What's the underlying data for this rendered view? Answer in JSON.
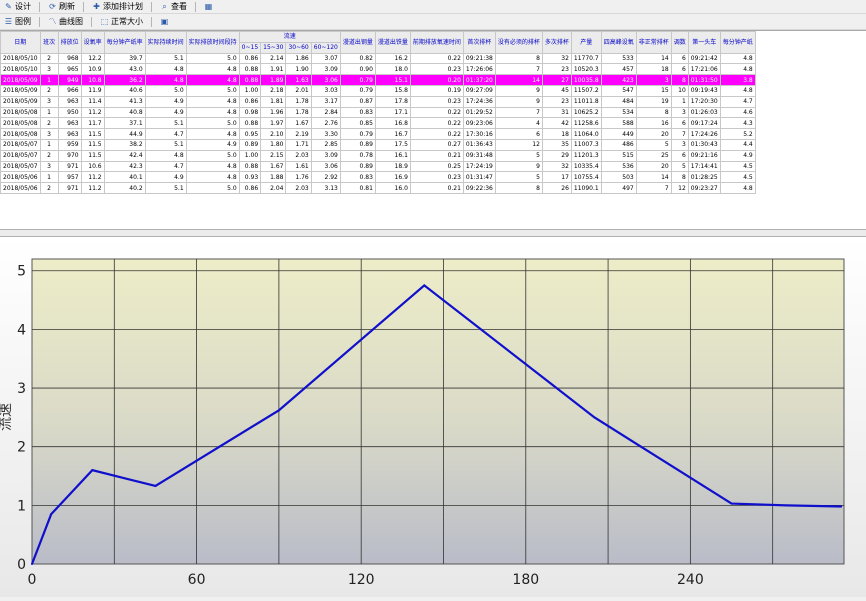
{
  "toolbar1": [
    {
      "icon": "design-icon",
      "label": "设计"
    },
    {
      "icon": "refresh-icon",
      "label": "刷新"
    },
    {
      "icon": "add-plan-icon",
      "label": "添加排计划"
    },
    {
      "icon": "view-icon",
      "label": "查看"
    },
    {
      "icon": "export-icon",
      "label": ""
    }
  ],
  "toolbar2": [
    {
      "icon": "legend-icon",
      "label": "图例"
    },
    {
      "icon": "curve-icon",
      "label": "曲线图"
    },
    {
      "icon": "normal-size-icon",
      "label": "正常大小"
    },
    {
      "icon": "save-icon",
      "label": ""
    }
  ],
  "table": {
    "group_header": "流速",
    "headers": [
      "日期",
      "班次",
      "排放位",
      "设氧率",
      "每分钟产纸率",
      "实际持续时间",
      "实际排放时间段持",
      "0~15",
      "15~30",
      "30~60",
      "60~120",
      "漫道出钢量",
      "漫道出铁量",
      "前期排放氧速时间",
      "首次排杯",
      "没有必须的排杯",
      "多次排杯",
      "产量",
      "四高峰设氧",
      "非正常排杯",
      "调数",
      "第一头车",
      "每分钟产纸"
    ],
    "rows": [
      [
        "2018/05/10",
        "2",
        "968",
        "12.2",
        "39.7",
        "5.1",
        "5.0",
        "0.86",
        "2.14",
        "1.86",
        "3.07",
        "0.82",
        "16.2",
        "0.22",
        "09:21:38",
        "8",
        "32",
        "11770.7",
        "533",
        "14",
        "6",
        "09:21:42",
        "4.8"
      ],
      [
        "2018/05/10",
        "3",
        "965",
        "10.9",
        "43.0",
        "4.8",
        "4.8",
        "0.88",
        "1.91",
        "1.90",
        "3.09",
        "0.90",
        "18.0",
        "0.23",
        "17:26:06",
        "7",
        "23",
        "10520.3",
        "457",
        "18",
        "6",
        "17:21:06",
        "4.8"
      ],
      [
        "2018/05/09",
        "1",
        "949",
        "10.8",
        "36.2",
        "4.8",
        "4.8",
        "0.88",
        "1.89",
        "1.63",
        "3.06",
        "0.79",
        "15.1",
        "0.20",
        "01:37:20",
        "14",
        "27",
        "10035.8",
        "423",
        "3",
        "8",
        "01:31:50",
        "3.8"
      ],
      [
        "2018/05/09",
        "2",
        "966",
        "11.9",
        "40.6",
        "5.0",
        "5.0",
        "1.00",
        "2.18",
        "2.01",
        "3.03",
        "0.79",
        "15.8",
        "0.19",
        "09:27:09",
        "9",
        "45",
        "11507.2",
        "547",
        "15",
        "10",
        "09:19:43",
        "4.8"
      ],
      [
        "2018/05/09",
        "3",
        "963",
        "11.4",
        "41.3",
        "4.9",
        "4.8",
        "0.86",
        "1.81",
        "1.78",
        "3.17",
        "0.87",
        "17.8",
        "0.23",
        "17:24:36",
        "9",
        "23",
        "11011.8",
        "484",
        "19",
        "1",
        "17:20:30",
        "4.7"
      ],
      [
        "2018/05/08",
        "1",
        "950",
        "11.2",
        "40.8",
        "4.9",
        "4.8",
        "0.98",
        "1.96",
        "1.78",
        "2.84",
        "0.83",
        "17.1",
        "0.22",
        "01:29:52",
        "7",
        "31",
        "10625.2",
        "534",
        "8",
        "3",
        "01:26:03",
        "4.6"
      ],
      [
        "2018/05/08",
        "2",
        "963",
        "11.7",
        "37.1",
        "5.1",
        "5.0",
        "0.88",
        "1.97",
        "1.67",
        "2.76",
        "0.85",
        "16.8",
        "0.22",
        "09:23:06",
        "4",
        "42",
        "11258.6",
        "588",
        "16",
        "6",
        "09:17:24",
        "4.3"
      ],
      [
        "2018/05/08",
        "3",
        "963",
        "11.5",
        "44.9",
        "4.7",
        "4.8",
        "0.95",
        "2.10",
        "2.19",
        "3.30",
        "0.79",
        "16.7",
        "0.22",
        "17:30:16",
        "6",
        "18",
        "11064.0",
        "449",
        "20",
        "7",
        "17:24:26",
        "5.2"
      ],
      [
        "2018/05/07",
        "1",
        "959",
        "11.5",
        "38.2",
        "5.1",
        "4.9",
        "0.89",
        "1.80",
        "1.71",
        "2.85",
        "0.89",
        "17.5",
        "0.27",
        "01:36:43",
        "12",
        "35",
        "11007.3",
        "486",
        "5",
        "3",
        "01:30:43",
        "4.4"
      ],
      [
        "2018/05/07",
        "2",
        "970",
        "11.5",
        "42.4",
        "4.8",
        "5.0",
        "1.00",
        "2.15",
        "2.03",
        "3.09",
        "0.78",
        "16.1",
        "0.21",
        "09:31:48",
        "5",
        "29",
        "11201.3",
        "515",
        "25",
        "6",
        "09:21:16",
        "4.9"
      ],
      [
        "2018/05/07",
        "3",
        "971",
        "10.6",
        "42.3",
        "4.7",
        "4.8",
        "0.88",
        "1.67",
        "1.61",
        "3.06",
        "0.89",
        "18.9",
        "0.25",
        "17:24:19",
        "9",
        "32",
        "10335.4",
        "536",
        "20",
        "5",
        "17:14:41",
        "4.5"
      ],
      [
        "2018/05/06",
        "1",
        "957",
        "11.2",
        "40.1",
        "4.9",
        "4.8",
        "0.93",
        "1.88",
        "1.76",
        "2.92",
        "0.83",
        "16.9",
        "0.23",
        "01:31:47",
        "5",
        "17",
        "10755.4",
        "503",
        "14",
        "8",
        "01:28:25",
        "4.5"
      ],
      [
        "2018/05/06",
        "2",
        "971",
        "11.2",
        "40.2",
        "5.1",
        "5.0",
        "0.86",
        "2.04",
        "2.03",
        "3.13",
        "0.81",
        "16.0",
        "0.21",
        "09:22:36",
        "8",
        "26",
        "11090.1",
        "497",
        "7",
        "12",
        "09:23:27",
        "4.8"
      ]
    ]
  },
  "chart_data": {
    "type": "line",
    "ylabel": "流速",
    "xlabel": "",
    "xlim": [
      0,
      296
    ],
    "ylim": [
      0,
      5.2
    ],
    "x_ticks": [
      0,
      60,
      120,
      180,
      240
    ],
    "y_ticks": [
      0,
      1,
      2,
      3,
      4,
      5
    ],
    "grid": true,
    "series": [
      {
        "color": "#1010cc",
        "x": [
          0,
          7,
          22,
          45,
          90,
          143,
          205,
          255,
          275,
          295
        ],
        "y": [
          0,
          0.85,
          1.6,
          1.33,
          2.62,
          4.75,
          2.5,
          1.03,
          1.0,
          0.98
        ]
      }
    ]
  },
  "colors": {
    "selected_row": "#ff00ff",
    "highlight_cell": "#ffff00",
    "line": "#1010cc"
  }
}
